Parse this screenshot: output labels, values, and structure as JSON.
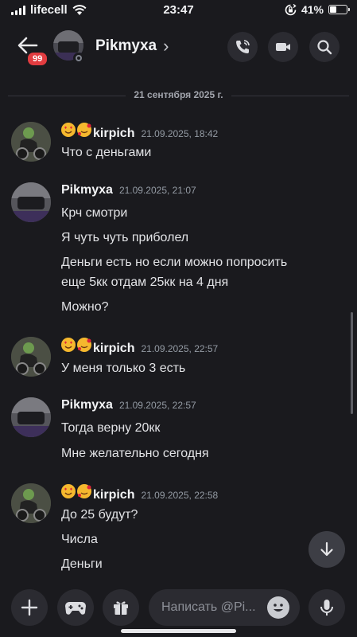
{
  "status_bar": {
    "carrier": "lifecell",
    "time": "23:47",
    "battery": "41%"
  },
  "header": {
    "unread_badge": "99",
    "contact_name": "Pikmyxa",
    "chevron": "›",
    "icons": [
      "back-arrow-icon",
      "phone-call-icon",
      "video-camera-icon",
      "search-icon"
    ]
  },
  "date_separator": "21 сентября 2025 г.",
  "messages": [
    {
      "author": "kirpich",
      "emojis": [
        "heart-eyes-emoji",
        "smiling-hearts-emoji"
      ],
      "timestamp": "21.09.2025, 18:42",
      "lines": [
        "Что с деньгами"
      ]
    },
    {
      "author": "Pikmyxa",
      "emojis": [],
      "timestamp": "21.09.2025, 21:07",
      "lines": [
        "Крч смотри",
        "Я чуть чуть приболел",
        "Деньги есть но если можно попросить",
        "еще 5кк отдам 25кк на 4 дня",
        "Можно?"
      ]
    },
    {
      "author": "kirpich",
      "emojis": [
        "heart-eyes-emoji",
        "smiling-hearts-emoji"
      ],
      "timestamp": "21.09.2025, 22:57",
      "lines": [
        "У меня только 3 есть"
      ]
    },
    {
      "author": "Pikmyxa",
      "emojis": [],
      "timestamp": "21.09.2025, 22:57",
      "lines": [
        "Тогда верну 20кк",
        "Мне желательно сегодня"
      ]
    },
    {
      "author": "kirpich",
      "emojis": [
        "heart-eyes-emoji",
        "smiling-hearts-emoji"
      ],
      "timestamp": "21.09.2025, 22:58",
      "lines": [
        "До 25 будут?",
        "Числа",
        "Деньги"
      ]
    }
  ],
  "composer": {
    "placeholder": "Написать @Pi...",
    "icons": [
      "plus-icon",
      "gamepad-icon",
      "gift-icon",
      "emoji-icon",
      "microphone-icon"
    ]
  },
  "colors": {
    "background": "#1a1a1e",
    "surface": "#2b2b31",
    "badge": "#e23c40",
    "muted_text": "#949ba4"
  }
}
